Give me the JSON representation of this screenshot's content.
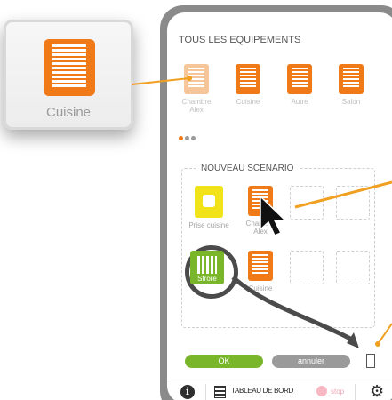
{
  "callout": {
    "label": "Cuisine"
  },
  "equipements": {
    "title": "TOUS LES EQUIPEMENTS",
    "items": [
      {
        "label": "Chambre Alex",
        "icon": "blinds-icon",
        "faded": true
      },
      {
        "label": "Cuisine",
        "icon": "blinds-icon",
        "faded": false
      },
      {
        "label": "Autre",
        "icon": "blinds-icon",
        "faded": false
      },
      {
        "label": "Salon",
        "icon": "blinds-icon",
        "faded": false
      }
    ],
    "pager_dots": [
      "#f07a17",
      "#9a9a9a",
      "#9a9a9a"
    ]
  },
  "scenario": {
    "title": "NOUVEAU SCENARIO",
    "items": [
      {
        "label": "Prise cuisine",
        "icon": "plug-icon"
      },
      {
        "label": "Chambre Alex",
        "icon": "blinds-icon"
      },
      {
        "label": "Strore",
        "icon": "awning-icon"
      },
      {
        "label": "Cuisine",
        "icon": "blinds-icon"
      }
    ]
  },
  "buttons": {
    "ok": "OK",
    "cancel": "annuler"
  },
  "bottom_bar": {
    "info": "i",
    "dashboard": "TABLEAU DE BORD",
    "stop": "stop",
    "gear": "⚙"
  },
  "colors": {
    "orange": "#f07a17",
    "green": "#7ab62a",
    "yellow": "#f2e21a",
    "gray": "#9a9a9a"
  }
}
